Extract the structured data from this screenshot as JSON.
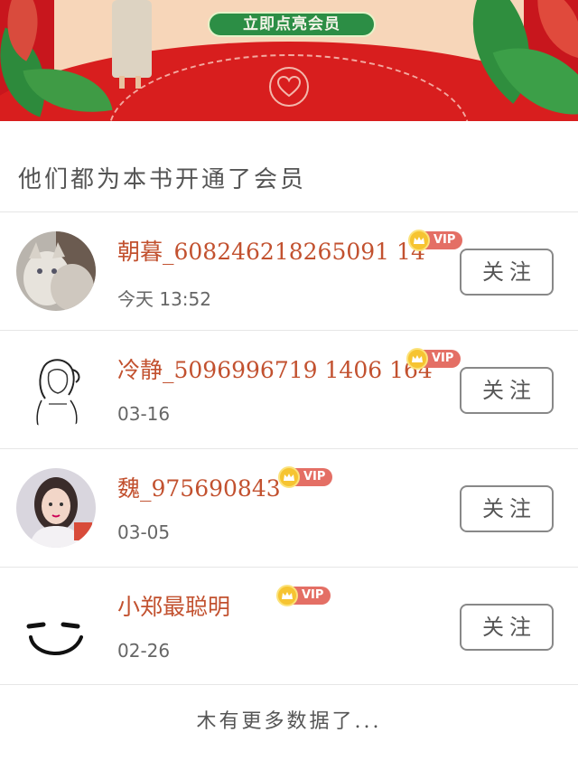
{
  "banner": {
    "cta_label": "立即点亮会员"
  },
  "section": {
    "title": "他们都为本书开通了会员"
  },
  "members": [
    {
      "name": "朝暮_608246218265091 14",
      "time": "今天 13:52",
      "badge": "VIP",
      "follow_label": "关注",
      "avatar": "cat-photo"
    },
    {
      "name": "冷静_5096996719 1406 164",
      "time": "03-16",
      "badge": "VIP",
      "follow_label": "关注",
      "avatar": "sketch-girl"
    },
    {
      "name": "魏_975690843",
      "time": "03-05",
      "badge": "VIP",
      "follow_label": "关注",
      "avatar": "girl-photo"
    },
    {
      "name": "小郑最聪明",
      "time": "02-26",
      "badge": "VIP",
      "follow_label": "关注",
      "avatar": "smile-face"
    }
  ],
  "footer": {
    "text": "木有更多数据了..."
  },
  "colors": {
    "banner_red": "#c8161d",
    "cta_green": "#2c8e45",
    "name_color": "#c2512f",
    "vip_tag": "#e46f65"
  }
}
